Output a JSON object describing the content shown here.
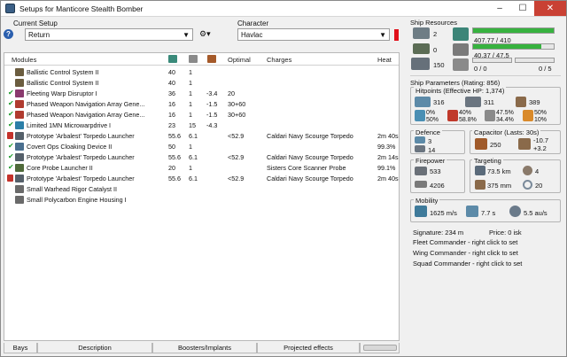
{
  "window": {
    "title": "Setups for Manticore Stealth Bomber"
  },
  "setup": {
    "label": "Current Setup",
    "value": "Return"
  },
  "character": {
    "label": "Character",
    "value": "Havlac"
  },
  "modules": {
    "columns": [
      "Modules",
      "Optimal",
      "Charges",
      "Heat"
    ],
    "rows": [
      {
        "state": "",
        "name": "Ballistic Control System II",
        "a": "40",
        "b": "1",
        "c": "",
        "optimal": "",
        "charges": "",
        "heat": "",
        "color": "#6b5d3f"
      },
      {
        "state": "",
        "name": "Ballistic Control System II",
        "a": "40",
        "b": "1",
        "c": "",
        "optimal": "",
        "charges": "",
        "heat": "",
        "color": "#6b5d3f"
      },
      {
        "state": "check",
        "name": "Fleeting Warp Disruptor I",
        "a": "36",
        "b": "1",
        "c": "-3.4",
        "optimal": "20",
        "charges": "",
        "heat": "",
        "color": "#8a3a6e"
      },
      {
        "state": "check",
        "name": "Phased Weapon Navigation Array Gene...",
        "a": "16",
        "b": "1",
        "c": "-1.5",
        "optimal": "30+60",
        "charges": "",
        "heat": "",
        "color": "#b03b2f"
      },
      {
        "state": "check",
        "name": "Phased Weapon Navigation Array Gene...",
        "a": "16",
        "b": "1",
        "c": "-1.5",
        "optimal": "30+60",
        "charges": "",
        "heat": "",
        "color": "#b03b2f"
      },
      {
        "state": "check",
        "name": "Limited 1MN Microwarpdrive I",
        "a": "23",
        "b": "15",
        "c": "-4.3",
        "optimal": "",
        "charges": "",
        "heat": "",
        "color": "#2c7fa8"
      },
      {
        "state": "hand",
        "name": "Prototype 'Arbalest' Torpedo Launcher",
        "a": "55.6",
        "b": "6.1",
        "c": "",
        "optimal": "<52.9",
        "charges": "Caldari Navy Scourge Torpedo",
        "heat": "2m 40s",
        "color": "#55606a"
      },
      {
        "state": "check",
        "name": "Covert Ops Cloaking Device II",
        "a": "50",
        "b": "1",
        "c": "",
        "optimal": "",
        "charges": "",
        "heat": "99.3%",
        "color": "#4a6f8f"
      },
      {
        "state": "check",
        "name": "Prototype 'Arbalest' Torpedo Launcher",
        "a": "55.6",
        "b": "6.1",
        "c": "",
        "optimal": "<52.9",
        "charges": "Caldari Navy Scourge Torpedo",
        "heat": "2m 14s",
        "color": "#55606a"
      },
      {
        "state": "check",
        "name": "Core Probe Launcher II",
        "a": "20",
        "b": "1",
        "c": "",
        "optimal": "",
        "charges": "Sisters Core Scanner Probe",
        "heat": "99.1%",
        "color": "#4f6a3a"
      },
      {
        "state": "hand",
        "name": "Prototype 'Arbalest' Torpedo Launcher",
        "a": "55.6",
        "b": "6.1",
        "c": "",
        "optimal": "<52.9",
        "charges": "Caldari Navy Scourge Torpedo",
        "heat": "2m 40s",
        "color": "#55606a"
      },
      {
        "state": "",
        "name": "Small Warhead Rigor Catalyst II",
        "a": "",
        "b": "",
        "c": "",
        "optimal": "",
        "charges": "",
        "heat": "",
        "color": "#6a6a6a"
      },
      {
        "state": "",
        "name": "Small Polycarbon Engine Housing I",
        "a": "",
        "b": "",
        "c": "",
        "optimal": "",
        "charges": "",
        "heat": "",
        "color": "#6a6a6a"
      }
    ]
  },
  "bottom_tabs": [
    "Bays",
    "Description",
    "Boosters/Implants",
    "Projected effects"
  ],
  "resources": {
    "title": "Ship Resources",
    "left_values": [
      "2",
      "0",
      "150"
    ],
    "cpu": {
      "text": "407.77 / 410",
      "fill": 0.995
    },
    "power": {
      "text": "40.37 / 47.5",
      "fill": 0.85
    },
    "drones_a": "0 / 0",
    "drones_b": "0 / 5"
  },
  "params": {
    "title": "Ship Parameters (Rating: 856)",
    "hitpoints_title": "Hitpoints (Effective HP: 1,374)",
    "hp": [
      "316",
      "311",
      "389"
    ],
    "resists": [
      [
        "0%",
        "50%"
      ],
      [
        "40%",
        "58.8%"
      ],
      [
        "47.5%",
        "34.4%"
      ],
      [
        "50%",
        "10%"
      ]
    ],
    "defence_title": "Defence",
    "defence": [
      "3",
      "14"
    ],
    "capacitor_title": "Capacitor (Lasts: 30s)",
    "capacitor": [
      "250",
      "-10.7",
      "+3.2"
    ],
    "firepower_title": "Firepower",
    "firepower": [
      "533",
      "4206"
    ],
    "targeting_title": "Targeting",
    "targeting": [
      "73.5 km",
      "4",
      "375 mm",
      "20"
    ],
    "mobility_title": "Mobility",
    "mobility": [
      "1625 m/s",
      "7.7 s",
      "5.5 au/s"
    ],
    "signature": "Signature: 234 m",
    "price": "Price: 0 isk",
    "fleet": "Fleet Commander - right click to set",
    "wing": "Wing Commander - right click to set",
    "squad": "Squad Commander - right click to set"
  }
}
